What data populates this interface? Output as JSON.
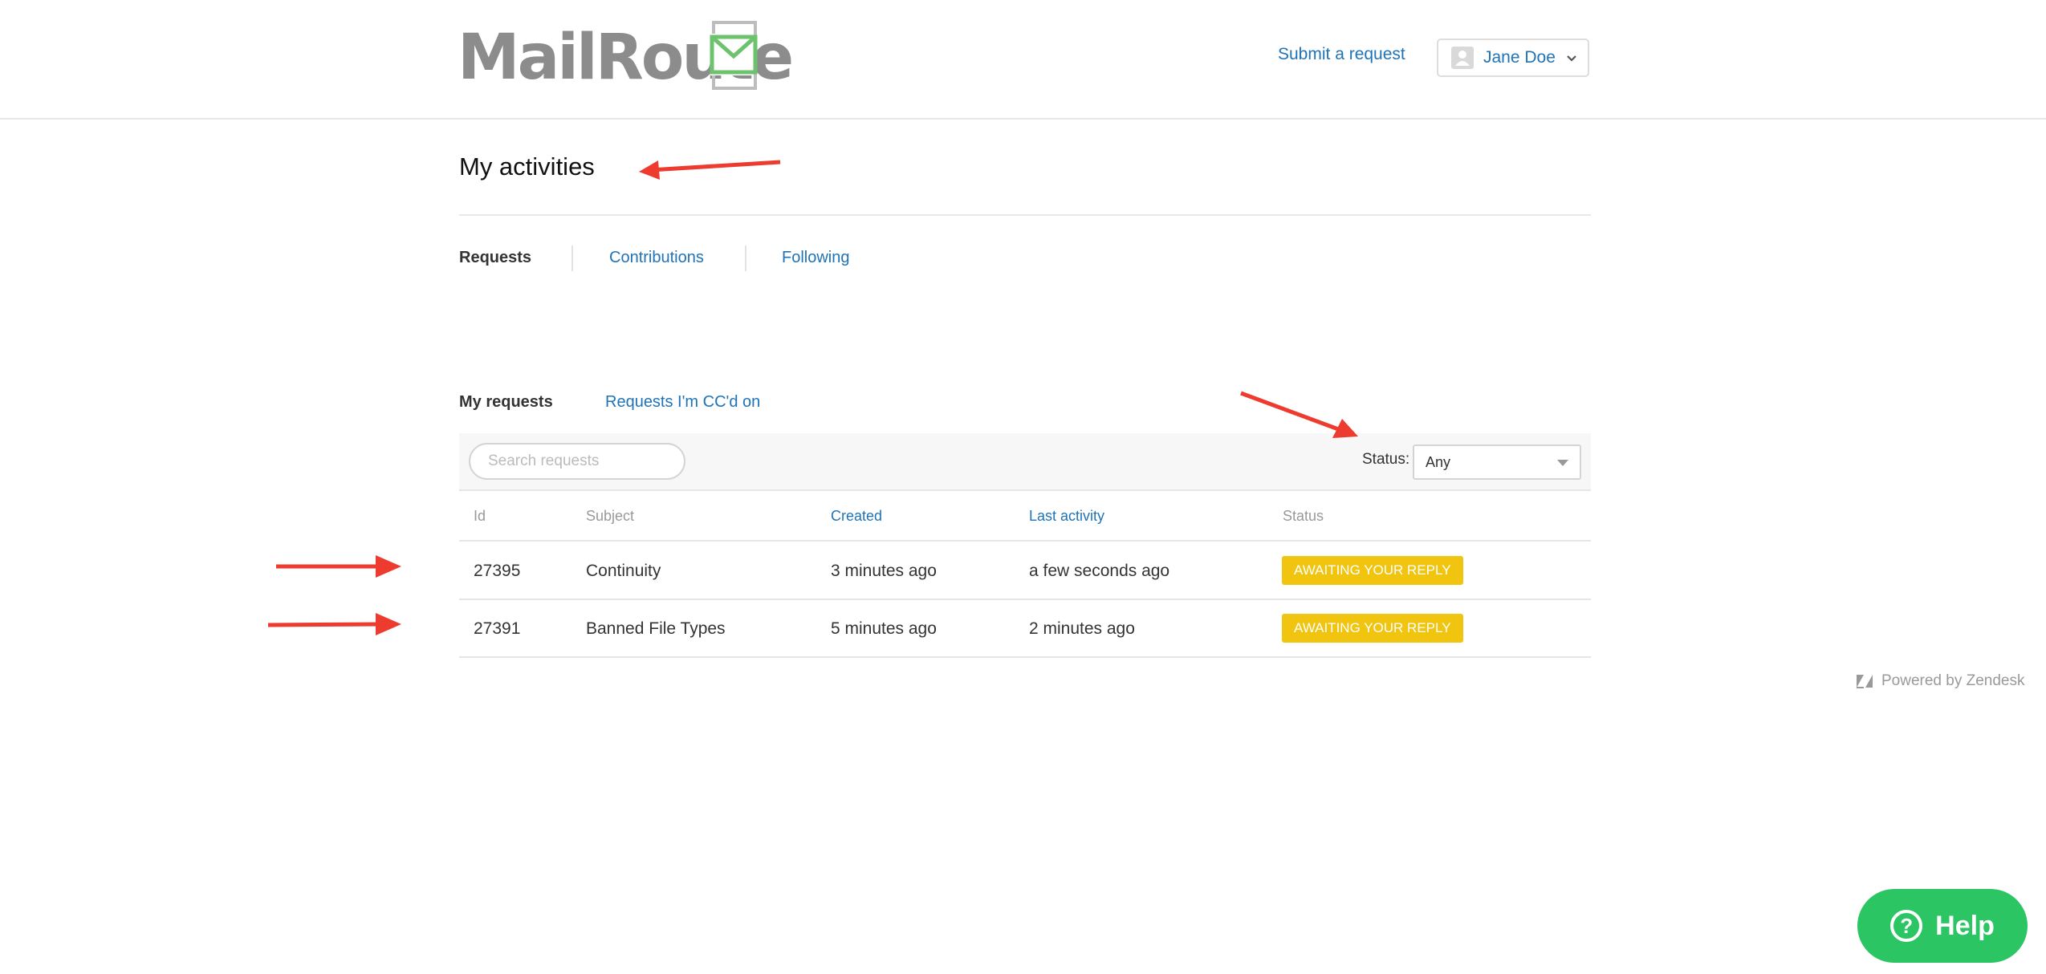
{
  "header": {
    "logo_text": "MailRoute",
    "submit_request": "Submit a request",
    "user_name": "Jane Doe"
  },
  "page": {
    "title": "My activities"
  },
  "tabs": [
    {
      "label": "Requests",
      "active": true
    },
    {
      "label": "Contributions",
      "active": false
    },
    {
      "label": "Following",
      "active": false
    }
  ],
  "subtabs": [
    {
      "label": "My requests",
      "active": true
    },
    {
      "label": "Requests I'm CC'd on",
      "active": false
    }
  ],
  "toolbar": {
    "search_placeholder": "Search requests",
    "status_label": "Status:",
    "status_value": "Any"
  },
  "table": {
    "headers": [
      "Id",
      "Subject",
      "Created",
      "Last activity",
      "Status"
    ],
    "rows": [
      {
        "id": "27395",
        "subject": "Continuity",
        "created": "3 minutes ago",
        "last_activity": "a few seconds ago",
        "status": "AWAITING YOUR REPLY"
      },
      {
        "id": "27391",
        "subject": "Banned File Types",
        "created": "5 minutes ago",
        "last_activity": "2 minutes ago",
        "status": "AWAITING YOUR REPLY"
      }
    ]
  },
  "footer": {
    "powered_by": "Powered by Zendesk",
    "help_label": "Help"
  },
  "colors": {
    "link": "#1f73b7",
    "badge": "#f1c40f",
    "help": "#2bc563",
    "annotation_arrow": "#ee3b30"
  }
}
